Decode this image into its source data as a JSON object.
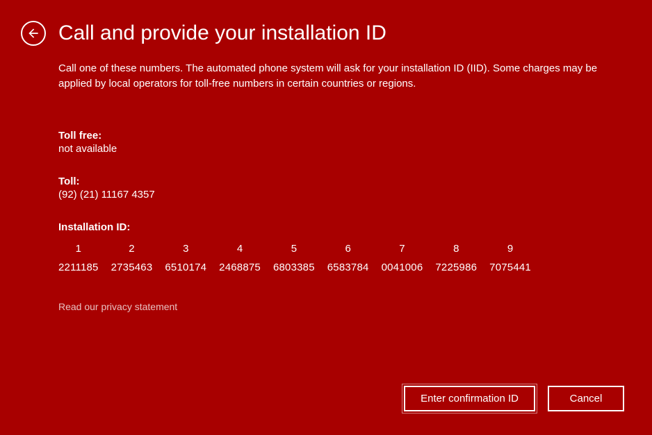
{
  "header": {
    "title": "Call and provide your installation ID"
  },
  "description": "Call one of these numbers. The automated phone system will ask for your installation ID (IID). Some charges may be applied by local operators for toll-free numbers in certain countries or regions.",
  "toll_free": {
    "label": "Toll free:",
    "value": "not available"
  },
  "toll": {
    "label": "Toll:",
    "value": "(92) (21) 11167 4357"
  },
  "installation_id": {
    "label": "Installation ID:",
    "columns": [
      {
        "index": "1",
        "value": "2211185"
      },
      {
        "index": "2",
        "value": "2735463"
      },
      {
        "index": "3",
        "value": "6510174"
      },
      {
        "index": "4",
        "value": "2468875"
      },
      {
        "index": "5",
        "value": "6803385"
      },
      {
        "index": "6",
        "value": "6583784"
      },
      {
        "index": "7",
        "value": "0041006"
      },
      {
        "index": "8",
        "value": "7225986"
      },
      {
        "index": "9",
        "value": "7075441"
      }
    ]
  },
  "privacy_link": "Read our privacy statement",
  "buttons": {
    "confirm": "Enter confirmation ID",
    "cancel": "Cancel"
  }
}
